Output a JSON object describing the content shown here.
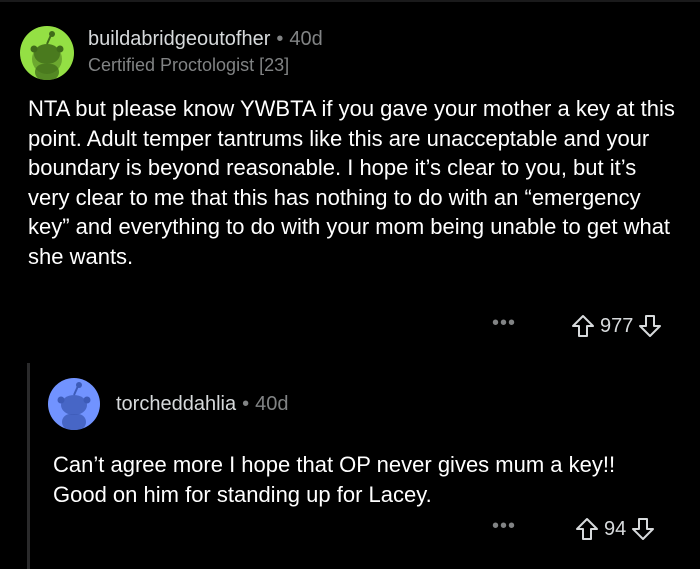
{
  "comment": {
    "username": "buildabridgeoutofher",
    "separator": "•",
    "age": "40d",
    "flair": "Certified Proctologist [23]",
    "body": "NTA but please know YWBTA if you gave your mother a key at this point. Adult temper tantrums like this are unacceptable and your boundary is beyond reasonable. I hope it’s clear to you, but it’s very clear to me that this has nothing to do with an “emergency key” and everything to do with your mom being unable to get what she wants.",
    "more_label": "•••",
    "score": "977",
    "avatar_color": "#94e044",
    "avatar_icon": "reddit-snoo-icon"
  },
  "reply": {
    "username": "torcheddahlia",
    "separator": "•",
    "age": "40d",
    "body": "Can’t agree more I hope that OP never gives mum a key!! Good on him for standing up for Lacey.",
    "more_label": "•••",
    "score": "94",
    "avatar_color": "#7193ff",
    "avatar_icon": "reddit-snoo-icon"
  },
  "colors": {
    "background": "#000000",
    "text": "#ffffff",
    "meta": "#818384"
  }
}
